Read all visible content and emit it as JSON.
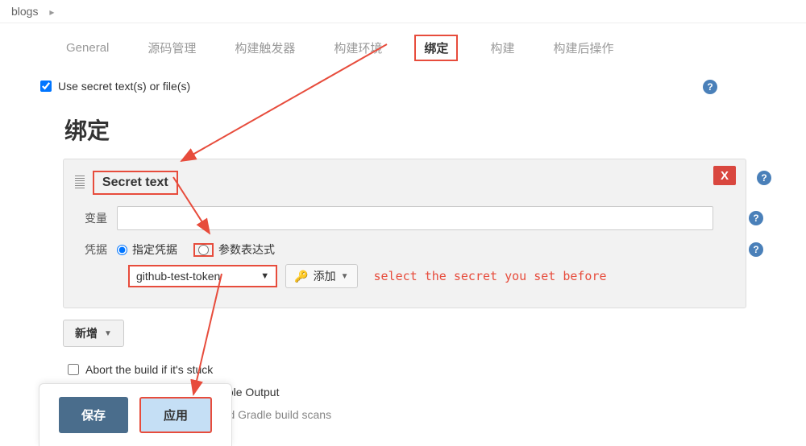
{
  "breadcrumb": {
    "item": "blogs"
  },
  "tabs": {
    "general": "General",
    "scm": "源码管理",
    "trigger": "构建触发器",
    "env": "构建环境",
    "binding": "绑定",
    "build": "构建",
    "postbuild": "构建后操作"
  },
  "secretCheckbox": {
    "label": "Use secret text(s) or file(s)"
  },
  "bindingTitle": "绑定",
  "secretText": {
    "label": "Secret text"
  },
  "removeBtn": {
    "label": "X"
  },
  "variable": {
    "label": "变量",
    "value": ""
  },
  "credential": {
    "label": "凭据",
    "option1": "指定凭据",
    "option2": "参数表达式",
    "selected": "github-test-token",
    "addLabel": "添加"
  },
  "annotation": "select the secret you set before",
  "newBtn": {
    "label": "新增"
  },
  "checkbox1": {
    "label": "Abort the build if it's stuck"
  },
  "checkbox2": {
    "label": "Add timestamps to the Console Output"
  },
  "checkbox3": {
    "label": "Inspect build log for published Gradle build scans"
  },
  "saveBtn": {
    "label": "保存"
  },
  "applyBtn": {
    "label": "应用"
  },
  "helpIcon": "?"
}
